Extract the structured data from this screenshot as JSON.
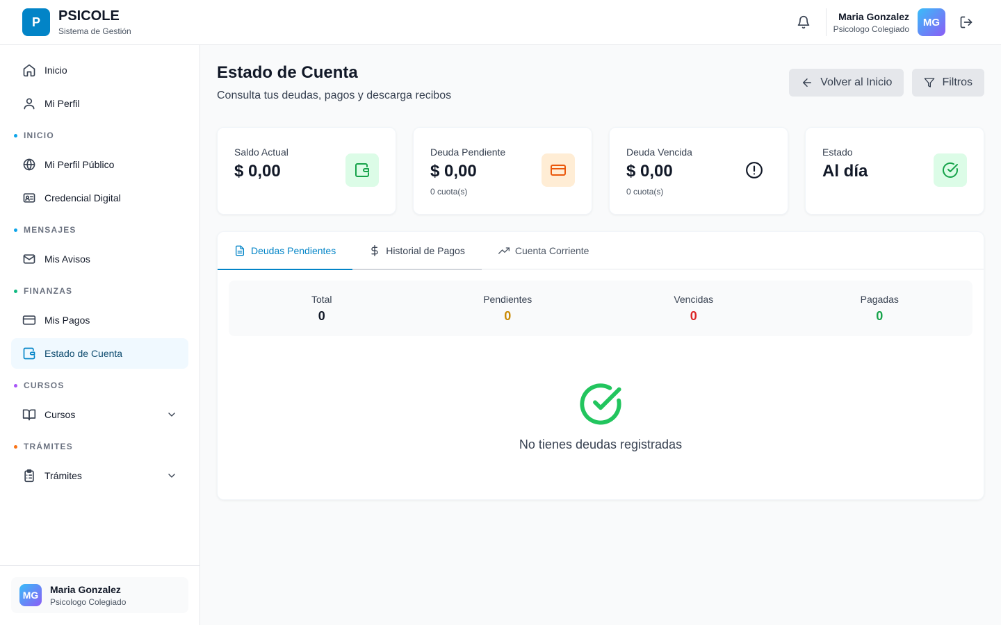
{
  "header": {
    "logo_letter": "P",
    "brand_name": "PSICOLE",
    "brand_sub": "Sistema de Gestión",
    "user_name": "Maria Gonzalez",
    "user_role": "Psicologo Colegiado",
    "user_initials": "MG"
  },
  "sidebar": {
    "top_items": [
      {
        "label": "Inicio",
        "icon": "home-icon"
      },
      {
        "label": "Mi Perfil",
        "icon": "user-icon"
      }
    ],
    "sections": [
      {
        "title": "INICIO",
        "dot_color": "#0ea5e9",
        "items": [
          {
            "label": "Mi Perfil Público",
            "icon": "globe-icon"
          },
          {
            "label": "Credencial Digital",
            "icon": "id-card-icon"
          }
        ]
      },
      {
        "title": "MENSAJES",
        "dot_color": "#0ea5e9",
        "items": [
          {
            "label": "Mis Avisos",
            "icon": "mail-icon"
          }
        ]
      },
      {
        "title": "FINANZAS",
        "dot_color": "#10b981",
        "items": [
          {
            "label": "Mis Pagos",
            "icon": "credit-card-icon"
          },
          {
            "label": "Estado de Cuenta",
            "icon": "wallet-icon",
            "active": true
          }
        ]
      },
      {
        "title": "CURSOS",
        "dot_color": "#a855f7",
        "items": [
          {
            "label": "Cursos",
            "icon": "book-open-icon",
            "expandable": true
          }
        ]
      },
      {
        "title": "TRÁMITES",
        "dot_color": "#f97316",
        "items": [
          {
            "label": "Trámites",
            "icon": "clipboard-icon",
            "expandable": true
          }
        ]
      }
    ],
    "footer": {
      "name": "Maria Gonzalez",
      "role": "Psicologo Colegiado",
      "initials": "MG"
    }
  },
  "page": {
    "title": "Estado de Cuenta",
    "subtitle": "Consulta tus deudas, pagos y descarga recibos",
    "back_label": "Volver al Inicio",
    "filters_label": "Filtros"
  },
  "cards": [
    {
      "label": "Saldo Actual",
      "value": "$ 0,00",
      "note": "",
      "icon": "wallet-icon",
      "icon_bg": "#dcfce7",
      "icon_color": "#16a34a"
    },
    {
      "label": "Deuda Pendiente",
      "value": "$ 0,00",
      "note": "0 cuota(s)",
      "icon": "credit-card-icon",
      "icon_bg": "#ffedd5",
      "icon_color": "#ea580c"
    },
    {
      "label": "Deuda Vencida",
      "value": "$ 0,00",
      "note": "0 cuota(s)",
      "icon": "alert-circle-icon",
      "icon_bg": "#ffffff",
      "icon_color": "#111827"
    },
    {
      "label": "Estado",
      "value": "Al día",
      "note": "",
      "icon": "check-circle-icon",
      "icon_bg": "#dcfce7",
      "icon_color": "#16a34a"
    }
  ],
  "tabs": [
    {
      "label": "Deudas Pendientes",
      "icon": "file-text-icon",
      "state": "active"
    },
    {
      "label": "Historial de Pagos",
      "icon": "dollar-icon",
      "state": "hovered"
    },
    {
      "label": "Cuenta Corriente",
      "icon": "trending-up-icon",
      "state": "normal"
    }
  ],
  "summary": [
    {
      "label": "Total",
      "value": "0",
      "color": "#111827"
    },
    {
      "label": "Pendientes",
      "value": "0",
      "color": "#ca8a04"
    },
    {
      "label": "Vencidas",
      "value": "0",
      "color": "#dc2626"
    },
    {
      "label": "Pagadas",
      "value": "0",
      "color": "#16a34a"
    }
  ],
  "empty_state": {
    "text": "No tienes deudas registradas",
    "icon": "check-circle-icon",
    "color": "#22c55e"
  }
}
